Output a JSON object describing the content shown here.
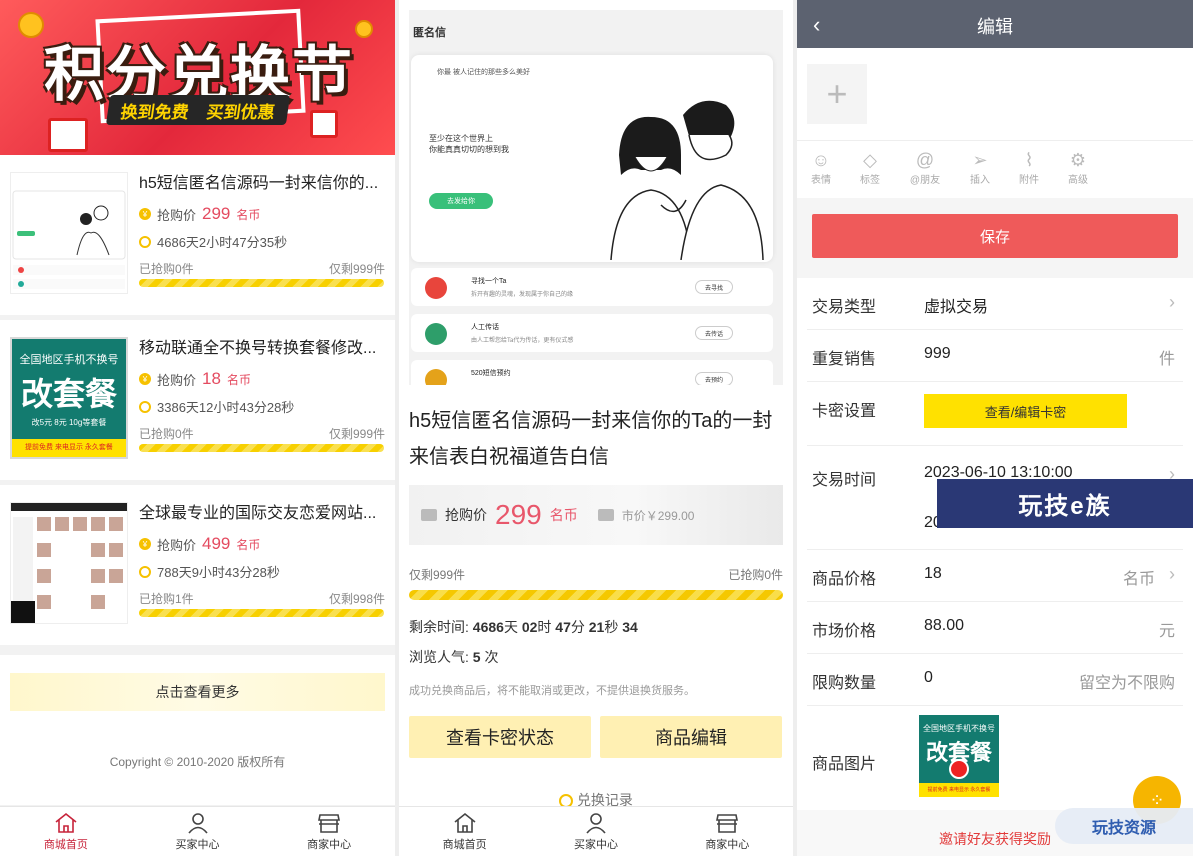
{
  "panel1": {
    "banner": {
      "title": "积分兑换节",
      "sub1": "换到免费",
      "sub2": "买到优惠"
    },
    "products": [
      {
        "title": "h5短信匿名信源码一封来信你的...",
        "price_label": "抢购价",
        "price": "299",
        "unit": "名币",
        "time": "4686天2小时47分35秒",
        "sold": "已抢购0件",
        "remain": "仅剩999件"
      },
      {
        "title": "移动联通全不换号转换套餐修改...",
        "price_label": "抢购价",
        "price": "18",
        "unit": "名币",
        "time": "3386天12小时43分28秒",
        "sold": "已抢购0件",
        "remain": "仅剩999件"
      },
      {
        "title": "全球最专业的国际交友恋爱网站...",
        "price_label": "抢购价",
        "price": "499",
        "unit": "名币",
        "time": "788天9小时43分28秒",
        "sold": "已抢购1件",
        "remain": "仅剩998件"
      }
    ],
    "thumb2": {
      "top": "全国地区手机不换号",
      "main": "改套餐",
      "line": "改5元  8元  10g等套餐",
      "foot": "提前免费 来电显示 永久套餐"
    },
    "more": "点击查看更多",
    "copyright": "Copyright © 2010-2020 版权所有"
  },
  "tabs": [
    {
      "label": "商城首页"
    },
    {
      "label": "买家中心"
    },
    {
      "label": "商家中心"
    }
  ],
  "panel2": {
    "shot": {
      "header": "匿名信",
      "card_label": "你最    被人记住的那些多么美好",
      "card_text1": "至少在这个世界上",
      "card_text2": "你能真真切切的想到我",
      "card_btn": "去发给你",
      "items": [
        {
          "name": "寻找一个Ta",
          "desc": "拆开有趣的灵魂，发现属于你自己的缘",
          "btn": "去寻找",
          "color": "#e8453c"
        },
        {
          "name": "人工传话",
          "desc": "由人工帮您给Ta代为传话，更有仪式感",
          "btn": "去传话",
          "color": "#2e9e6a"
        },
        {
          "name": "520短信预约",
          "desc": "",
          "btn": "去预约",
          "color": "#e4a21a"
        }
      ]
    },
    "title": "h5短信匿名信源码一封来信你的Ta的一封来信表白祝福道告白信",
    "price_label": "抢购价",
    "price": "299",
    "unit": "名币",
    "market": "市价￥299.00",
    "remain": "仅剩999件",
    "sold": "已抢购0件",
    "countdown_label": "剩余时间: ",
    "cd_days": "4686",
    "cd_days_unit": "天",
    "cd_hours": "02",
    "cd_hours_unit": "时",
    "cd_mins": "47",
    "cd_mins_unit": "分",
    "cd_secs": "21",
    "cd_secs_unit": "秒",
    "cd_ms": "34",
    "views_label": "浏览人气: ",
    "views": "5",
    "views_unit": "次",
    "note": "成功兑换商品后，将不能取消或更改，不提供退换货服务。",
    "btn_status": "查看卡密状态",
    "btn_edit": "商品编辑",
    "records": "兑换记录"
  },
  "panel3": {
    "nav_title": "编辑",
    "tools": [
      "表情",
      "标签",
      "@朋友",
      "插入",
      "附件",
      "高级"
    ],
    "save": "保存",
    "rows": {
      "type_k": "交易类型",
      "type_v": "虚拟交易",
      "resale_k": "重复销售",
      "resale_v": "999",
      "resale_u": "件",
      "card_k": "卡密设置",
      "card_btn": "查看/编辑卡密",
      "time_k": "交易时间",
      "time_v1": "2023-06-10 13:10:00",
      "time_v2": "2034-06-29 13:10:00",
      "price_k": "商品价格",
      "price_v": "18",
      "price_u": "名币",
      "market_k": "市场价格",
      "market_v": "88.00",
      "market_u": "元",
      "limit_k": "限购数量",
      "limit_v": "0",
      "limit_u": "留空为不限购",
      "img_k": "商品图片"
    },
    "invite": "邀请好友获得奖励"
  },
  "watermark1": "玩技e族",
  "watermark2": "玩技资源"
}
